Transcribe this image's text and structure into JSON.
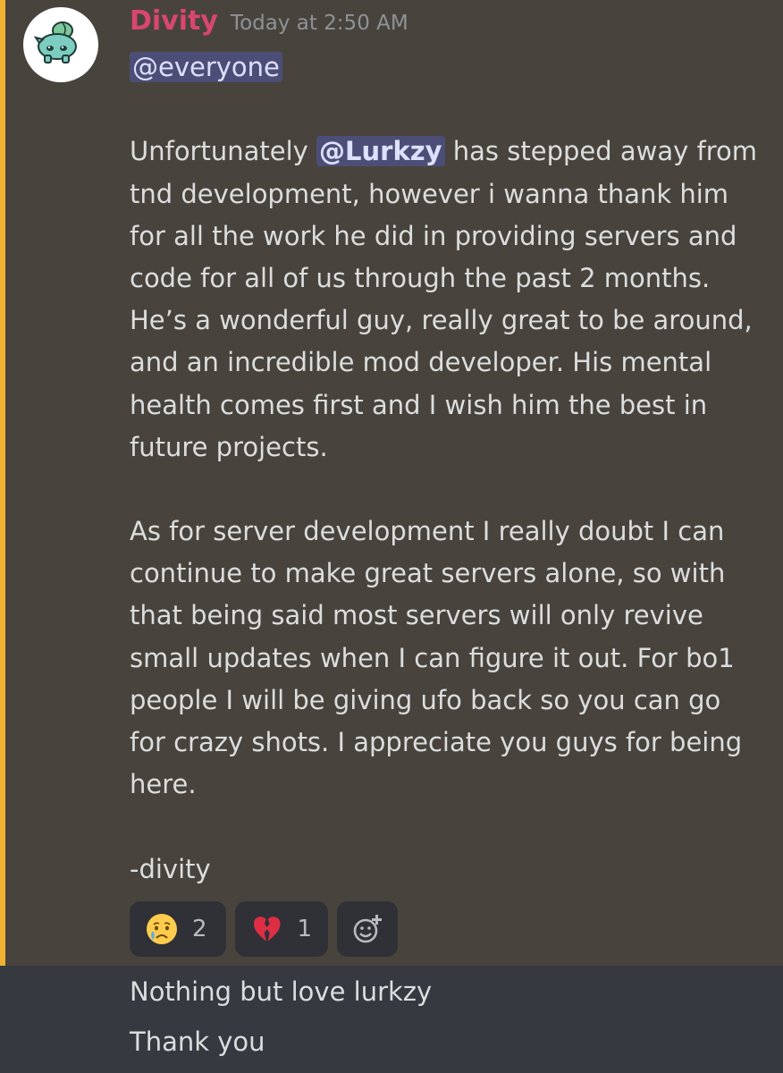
{
  "message": {
    "author": "Divity",
    "timestamp": "Today at 2:50 AM",
    "mention_everyone": "@everyone",
    "p1_pre": "Unfortunately ",
    "p1_mention": "@Lurkzy",
    "p1_post": " has stepped away from",
    "p1_lines": [
      "tnd development, however i wanna thank him",
      "for all the work he did in providing servers and",
      "code for all of us through the past 2 months.",
      "He’s a wonderful guy, really great to be around,",
      "and an incredible mod developer. His mental",
      "health comes first and I wish him the best in",
      "future projects."
    ],
    "p2_lines": [
      "As for server development I really doubt I can",
      "continue to make great servers alone, so with",
      "that being said most servers will only revive",
      "small updates when I can figure it out. For bo1",
      "people I will be giving ufo back so you can go",
      "for crazy shots. I appreciate you guys for being",
      "here."
    ],
    "signature": "-divity"
  },
  "reactions": [
    {
      "emoji": "crying-face",
      "count": "2"
    },
    {
      "emoji": "broken-heart",
      "count": "1"
    }
  ],
  "followups": [
    "Nothing but love lurkzy",
    "Thank you"
  ],
  "colors": {
    "highlight_bg": "#48443d",
    "highlight_bar": "#f0b232",
    "author": "#d94672",
    "channel_bg": "#36393f"
  }
}
